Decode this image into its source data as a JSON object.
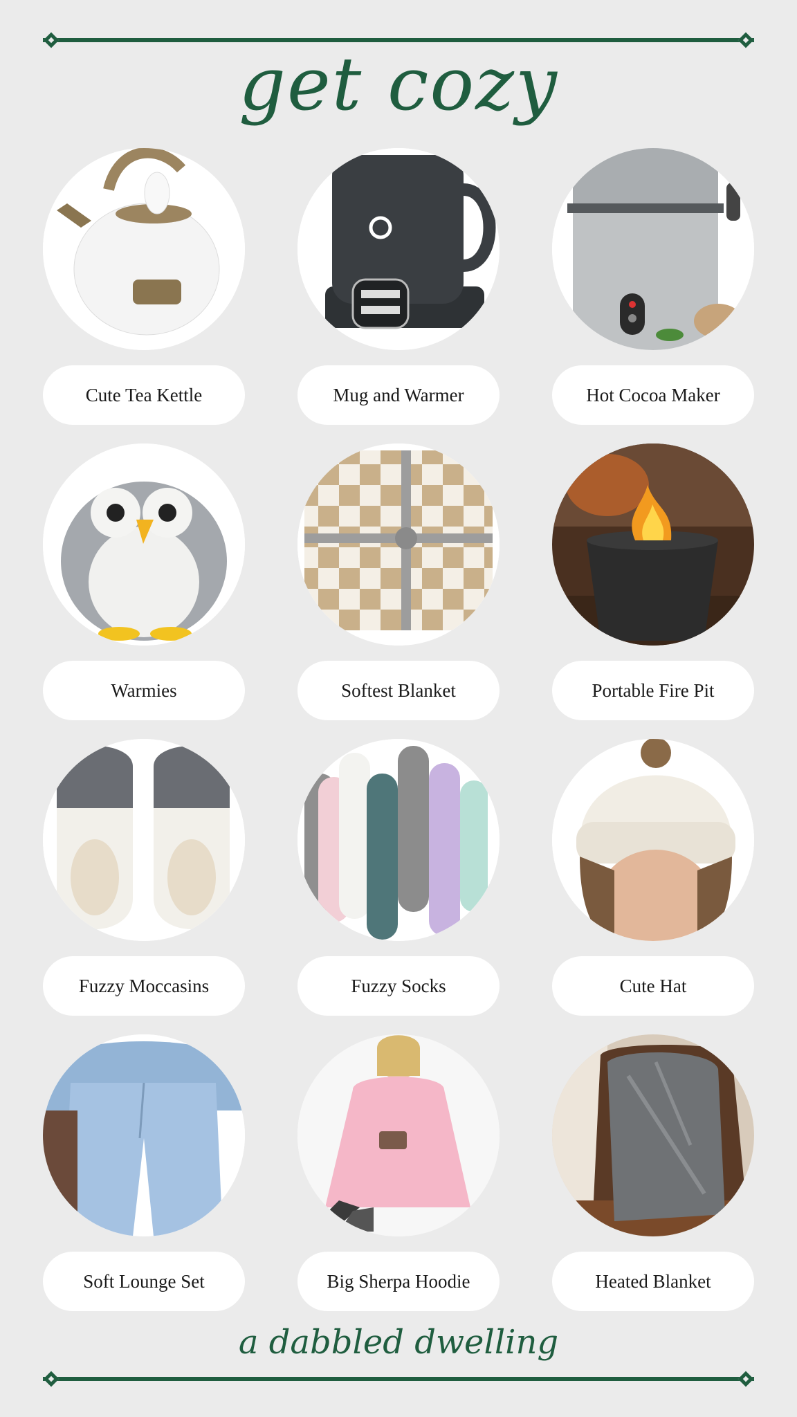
{
  "title": "get cozy",
  "footer": "a dabbled dwelling",
  "items": [
    {
      "label": "Cute Tea Kettle"
    },
    {
      "label": "Mug and Warmer"
    },
    {
      "label": "Hot Cocoa Maker"
    },
    {
      "label": "Warmies"
    },
    {
      "label": "Softest Blanket"
    },
    {
      "label": "Portable Fire Pit"
    },
    {
      "label": "Fuzzy Moccasins"
    },
    {
      "label": "Fuzzy Socks"
    },
    {
      "label": "Cute Hat"
    },
    {
      "label": "Soft Lounge Set"
    },
    {
      "label": "Big Sherpa Hoodie"
    },
    {
      "label": "Heated Blanket"
    }
  ],
  "colors": {
    "accent": "#1f5d3f",
    "background": "#ebebeb",
    "pill": "#ffffff"
  }
}
